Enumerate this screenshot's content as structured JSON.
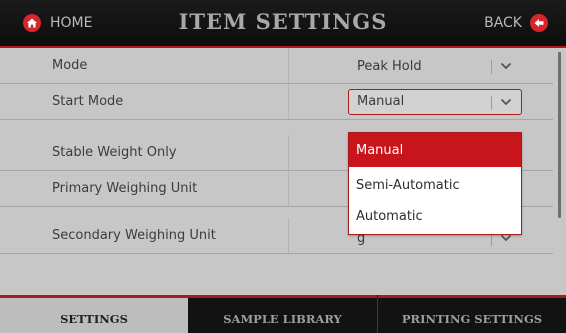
{
  "header": {
    "title": "ITEM SETTINGS",
    "home_label": "HOME",
    "back_label": "BACK"
  },
  "settings": {
    "rows": [
      {
        "label": "Mode",
        "value": "Peak Hold"
      },
      {
        "label": "Start Mode",
        "value": "Manual"
      },
      {
        "label": "Stable Weight Only",
        "value": ""
      },
      {
        "label": "Primary Weighing Unit",
        "value": ""
      },
      {
        "label": "Secondary Weighing Unit",
        "value": "g"
      }
    ]
  },
  "dropdown": {
    "options": [
      "Manual",
      "Semi-Automatic",
      "Automatic"
    ],
    "selected": "Manual"
  },
  "tabs": [
    {
      "label": "SETTINGS",
      "active": true
    },
    {
      "label": "SAMPLE LIBRARY",
      "active": false
    },
    {
      "label": "PRINTING SETTINGS",
      "active": false
    }
  ],
  "colors": {
    "accent": "#c8141b",
    "header_bg": "#111111",
    "list_bg": "#c7c7c7"
  },
  "icons": {
    "home": "home-icon",
    "back": "back-arrow-icon",
    "dropdown": "chevron-down-icon"
  }
}
